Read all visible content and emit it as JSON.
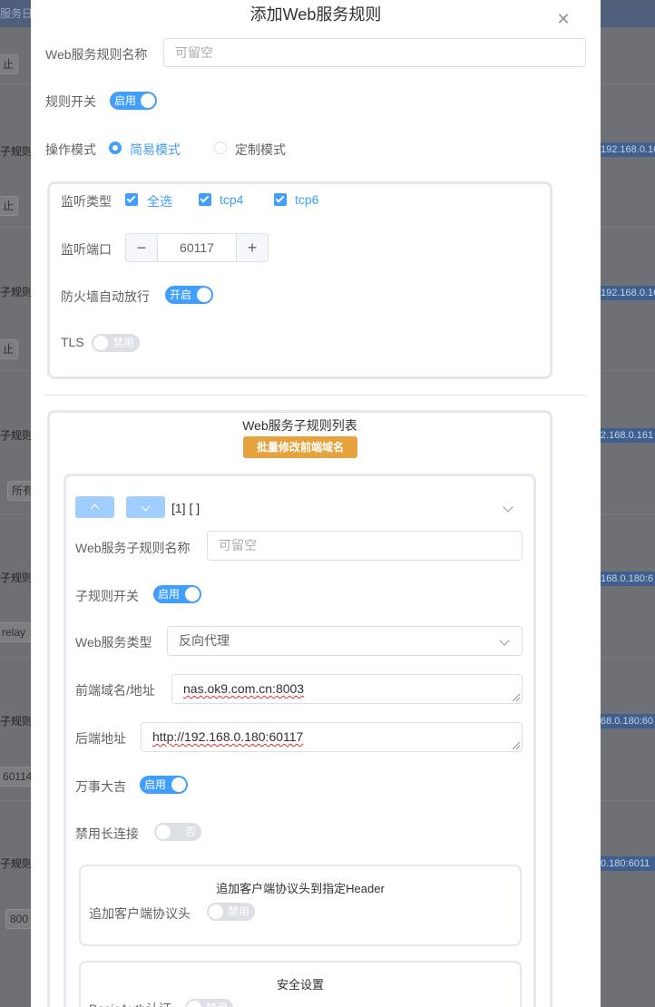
{
  "background": {
    "top_text": "服务日志",
    "buttons": [
      "止",
      "止",
      "止",
      "所有",
      "relay",
      "60114",
      "800"
    ],
    "rule_labels": [
      "子规则",
      "子规则",
      "子规则",
      "子规则",
      "子规则",
      "子规则"
    ],
    "ips": [
      "192.168.0.16",
      "192.168.0.16",
      "2.168.0.161",
      "168.0.180:6",
      "68.0.180:60",
      "0.180:6011"
    ]
  },
  "dialog": {
    "title": "添加Web服务规则",
    "rule_name": {
      "label": "Web服务规则名称",
      "placeholder": "可留空"
    },
    "rule_switch": {
      "label": "规则开关",
      "text": "启用"
    },
    "mode": {
      "label": "操作模式",
      "options": [
        "简易模式",
        "定制模式"
      ],
      "selected": "简易模式"
    },
    "listen": {
      "type_label": "监听类型",
      "types": [
        "全选",
        "tcp4",
        "tcp6"
      ],
      "port_label": "监听端口",
      "port_value": "60117",
      "firewall_label": "防火墙自动放行",
      "firewall_text": "开启",
      "tls_label": "TLS",
      "tls_text": "禁用"
    },
    "subrules": {
      "title": "Web服务子规则列表",
      "batch_button": "批量修改前端域名",
      "item": {
        "index": "[1] [ ]",
        "name_label": "Web服务子规则名称",
        "name_placeholder": "可留空",
        "switch_label": "子规则开关",
        "switch_text": "启用",
        "type_label": "Web服务类型",
        "type_value": "反向代理",
        "frontend_label": "前端域名/地址",
        "frontend_value": "nas.ok9.com.cn:8003",
        "backend_label": "后端地址",
        "backend_value": "http://192.168.0.180:60117",
        "luck_label": "万事大吉",
        "luck_text": "启用",
        "keepalive_label": "禁用长连接",
        "keepalive_text": "否",
        "header_section": {
          "title": "追加客户端协议头到指定Header",
          "label": "追加客户端协议头",
          "text": "禁用"
        },
        "security_section": {
          "title": "安全设置",
          "basic_auth_label": "BasicAuth认证",
          "basic_auth_text": "禁用"
        }
      }
    }
  }
}
